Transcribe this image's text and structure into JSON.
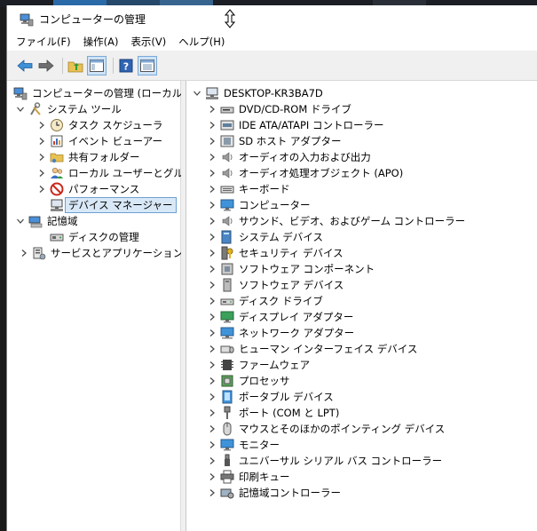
{
  "window": {
    "title": "コンピューターの管理"
  },
  "menu": [
    "ファイル(F)",
    "操作(A)",
    "表示(V)",
    "ヘルプ(H)"
  ],
  "toolbar": {
    "buttons": [
      "back-arrow-icon",
      "forward-arrow-icon",
      "up-folder-icon",
      "show-hide-tree-icon",
      "help-icon",
      "properties-icon"
    ]
  },
  "left_tree": {
    "root": "コンピューターの管理 (ローカル)",
    "system_tools": "システム ツール",
    "task_scheduler": "タスク スケジューラ",
    "event_viewer": "イベント ビューアー",
    "shared_folders": "共有フォルダー",
    "local_users": "ローカル ユーザーとグループ",
    "performance": "パフォーマンス",
    "device_manager": "デバイス マネージャー",
    "storage": "記憶域",
    "disk_management": "ディスクの管理",
    "services_apps": "サービスとアプリケーション"
  },
  "right_tree": {
    "computer_name": "DESKTOP-KR3BA7D",
    "categories": [
      {
        "label": "DVD/CD-ROM ドライブ",
        "icon": "dvd-drive-icon"
      },
      {
        "label": "IDE ATA/ATAPI コントローラー",
        "icon": "ide-controller-icon"
      },
      {
        "label": "SD ホスト アダプター",
        "icon": "sd-adapter-icon"
      },
      {
        "label": "オーディオの入力および出力",
        "icon": "speaker-icon"
      },
      {
        "label": "オーディオ処理オブジェクト (APO)",
        "icon": "speaker-icon"
      },
      {
        "label": "キーボード",
        "icon": "keyboard-icon"
      },
      {
        "label": "コンピューター",
        "icon": "monitor-icon"
      },
      {
        "label": "サウンド、ビデオ、およびゲーム コントローラー",
        "icon": "speaker-icon"
      },
      {
        "label": "システム デバイス",
        "icon": "system-device-icon"
      },
      {
        "label": "セキュリティ デバイス",
        "icon": "security-key-icon"
      },
      {
        "label": "ソフトウェア コンポーネント",
        "icon": "puzzle-icon"
      },
      {
        "label": "ソフトウェア デバイス",
        "icon": "software-device-icon"
      },
      {
        "label": "ディスク ドライブ",
        "icon": "disk-drive-icon"
      },
      {
        "label": "ディスプレイ アダプター",
        "icon": "display-adapter-icon"
      },
      {
        "label": "ネットワーク アダプター",
        "icon": "network-icon"
      },
      {
        "label": "ヒューマン インターフェイス デバイス",
        "icon": "hid-icon"
      },
      {
        "label": "ファームウェア",
        "icon": "firmware-icon"
      },
      {
        "label": "プロセッサ",
        "icon": "processor-icon"
      },
      {
        "label": "ポータブル デバイス",
        "icon": "portable-device-icon"
      },
      {
        "label": "ポート (COM と LPT)",
        "icon": "port-icon"
      },
      {
        "label": "マウスとそのほかのポインティング デバイス",
        "icon": "mouse-icon"
      },
      {
        "label": "モニター",
        "icon": "monitor-icon"
      },
      {
        "label": "ユニバーサル シリアル バス コントローラー",
        "icon": "usb-icon"
      },
      {
        "label": "印刷キュー",
        "icon": "printer-icon"
      },
      {
        "label": "記憶域コントローラー",
        "icon": "storage-controller-icon"
      }
    ]
  }
}
